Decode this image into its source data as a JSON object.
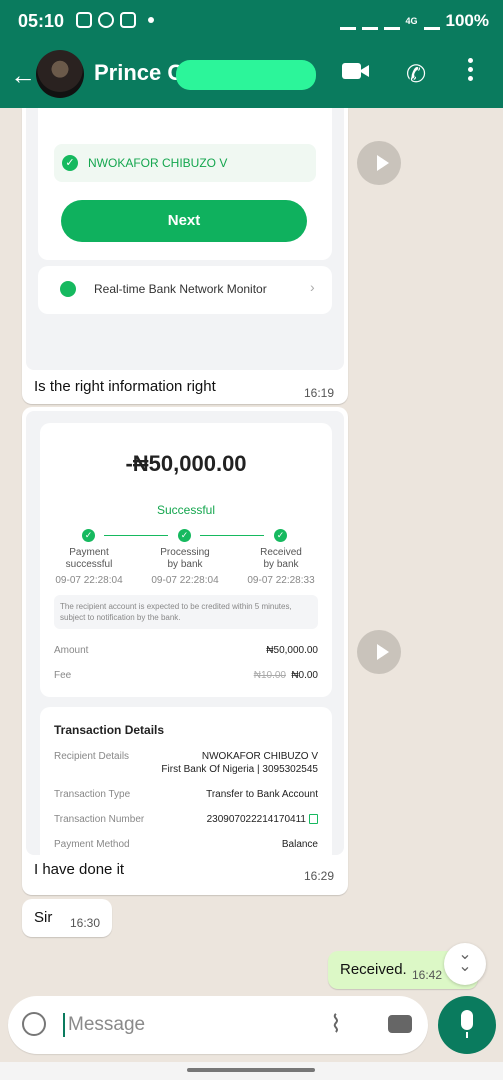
{
  "status_bar": {
    "time": "05:10",
    "battery": "100%",
    "network": "4G"
  },
  "header": {
    "contact_name": "Prince C"
  },
  "message1": {
    "check_name": "NWOKAFOR CHIBUZO V",
    "next_label": "Next",
    "monitor_label": "Real-time Bank Network Monitor",
    "caption": "Is the right information right",
    "time": "16:19"
  },
  "message2": {
    "amount": "-₦50,000.00",
    "status": "Successful",
    "steps": [
      {
        "line1": "Payment",
        "line2": "successful",
        "date": "09-07 22:28:04"
      },
      {
        "line1": "Processing",
        "line2": "by bank",
        "date": "09-07 22:28:04"
      },
      {
        "line1": "Received",
        "line2": "by bank",
        "date": "09-07 22:28:33"
      }
    ],
    "notice": "The recipient account is expected to be credited within 5 minutes, subject to notification by the bank.",
    "amount_label": "Amount",
    "amount_value": "₦50,000.00",
    "fee_label": "Fee",
    "fee_old": "₦10.00",
    "fee_value": "₦0.00",
    "details_title": "Transaction Details",
    "rows": [
      {
        "label": "Recipient Details",
        "value": "NWOKAFOR CHIBUZO V",
        "value2": "First Bank Of Nigeria | 3095302545"
      },
      {
        "label": "Transaction Type",
        "value": "Transfer to Bank Account"
      },
      {
        "label": "Transaction Number",
        "value": "230907022214170411"
      },
      {
        "label": "Payment Method",
        "value": "Balance"
      }
    ],
    "caption": "I have done it",
    "time": "16:29"
  },
  "message3": {
    "text": "Sir",
    "time": "16:30"
  },
  "message4": {
    "text": "Received.",
    "time": "16:42"
  },
  "input": {
    "placeholder": "Message"
  },
  "colors": {
    "header": "#0a7b5e",
    "chat_bg": "#ece5dd",
    "accent": "#0fb15e",
    "outgoing": "#dcf8c6",
    "blur": "#2cf59a"
  }
}
